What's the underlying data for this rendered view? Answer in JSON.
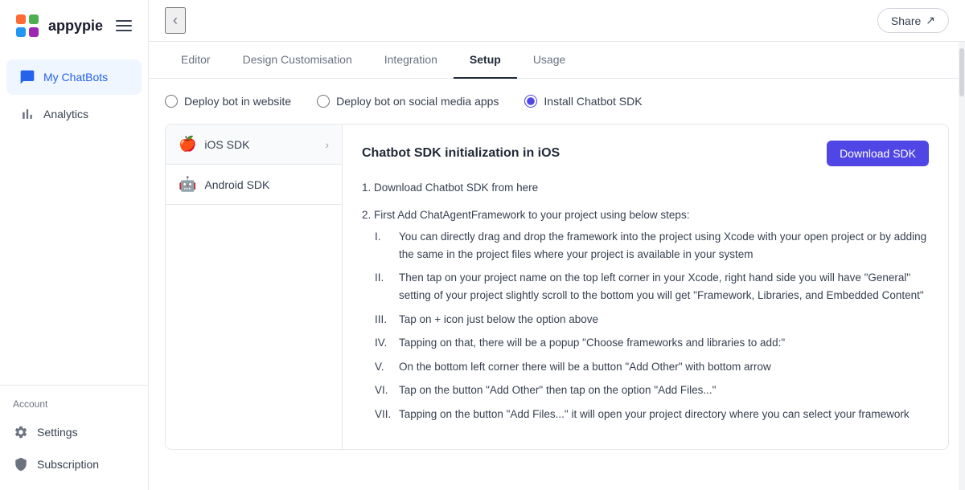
{
  "app": {
    "logo_text": "appypie",
    "logo_icon": "🟧"
  },
  "sidebar": {
    "nav_items": [
      {
        "id": "my-chatbots",
        "label": "My ChatBots",
        "active": true
      },
      {
        "id": "analytics",
        "label": "Analytics",
        "active": false
      }
    ],
    "account_label": "Account",
    "bottom_items": [
      {
        "id": "settings",
        "label": "Settings"
      },
      {
        "id": "subscription",
        "label": "Subscription"
      }
    ]
  },
  "header": {
    "share_label": "Share",
    "back_icon": "‹"
  },
  "tabs": [
    {
      "id": "editor",
      "label": "Editor",
      "active": false
    },
    {
      "id": "design-customisation",
      "label": "Design Customisation",
      "active": false
    },
    {
      "id": "integration",
      "label": "Integration",
      "active": false
    },
    {
      "id": "setup",
      "label": "Setup",
      "active": true
    },
    {
      "id": "usage",
      "label": "Usage",
      "active": false
    }
  ],
  "radio_options": [
    {
      "id": "deploy-website",
      "label": "Deploy bot in website",
      "checked": false
    },
    {
      "id": "deploy-social",
      "label": "Deploy bot on social media apps",
      "checked": false
    },
    {
      "id": "install-sdk",
      "label": "Install Chatbot SDK",
      "checked": true
    }
  ],
  "sdk": {
    "sidebar_items": [
      {
        "id": "ios",
        "label": "iOS SDK",
        "icon": "🍎",
        "active": true
      },
      {
        "id": "android",
        "label": "Android SDK",
        "icon": "🤖",
        "active": false
      }
    ],
    "content_title": "Chatbot SDK initialization in iOS",
    "download_label": "Download SDK",
    "steps": [
      {
        "num": "1.",
        "text": "Download Chatbot SDK from here"
      },
      {
        "num": "2.",
        "text": "First Add ChatAgentFramework to your project using below steps:",
        "sub_steps": [
          {
            "num": "I.",
            "text": "You can directly drag and drop the framework into the project using Xcode with your open project or by adding the same in the project files where your project is available in your system"
          },
          {
            "num": "II.",
            "text": "Then tap on your project name on the top left corner in your Xcode, right hand side you will have \"General\" setting of your project slightly scroll to the bottom you will get \"Framework, Libraries, and Embedded Content\""
          },
          {
            "num": "III.",
            "text": "Tap on + icon just below the option above"
          },
          {
            "num": "IV.",
            "text": "Tapping on that, there will be a popup \"Choose frameworks and libraries to add:\""
          },
          {
            "num": "V.",
            "text": "On the bottom left corner there will be a button \"Add Other\" with bottom arrow"
          },
          {
            "num": "VI.",
            "text": "Tap on the button \"Add Other\" then tap on the option \"Add Files...\""
          },
          {
            "num": "VII.",
            "text": "Tapping on the button \"Add Files...\" it will open your project directory where you can select your framework"
          }
        ]
      }
    ]
  }
}
